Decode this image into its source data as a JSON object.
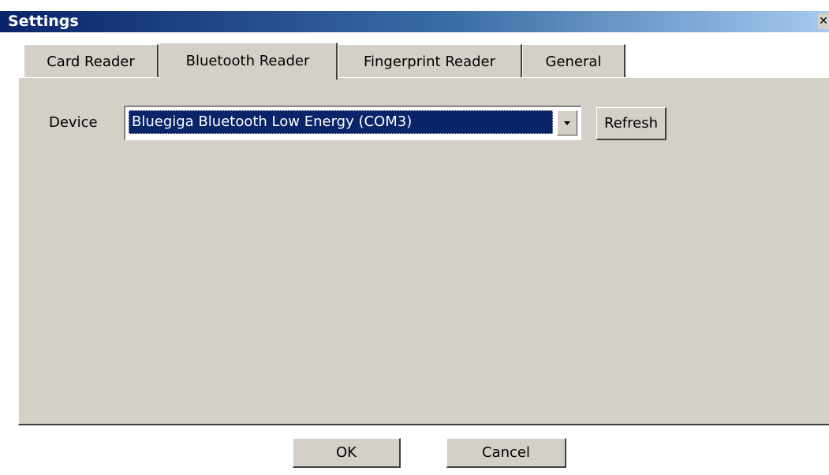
{
  "window": {
    "title": "Settings",
    "close_label": "✕"
  },
  "tabs": [
    {
      "label": "Card Reader",
      "active": false
    },
    {
      "label": "Bluetooth Reader",
      "active": true
    },
    {
      "label": "Fingerprint Reader",
      "active": false
    },
    {
      "label": "General",
      "active": false
    }
  ],
  "bluetooth": {
    "device_label": "Device",
    "device_value": "Bluegiga Bluetooth Low Energy (COM3)",
    "refresh_label": "Refresh"
  },
  "footer": {
    "ok_label": "OK",
    "cancel_label": "Cancel"
  }
}
